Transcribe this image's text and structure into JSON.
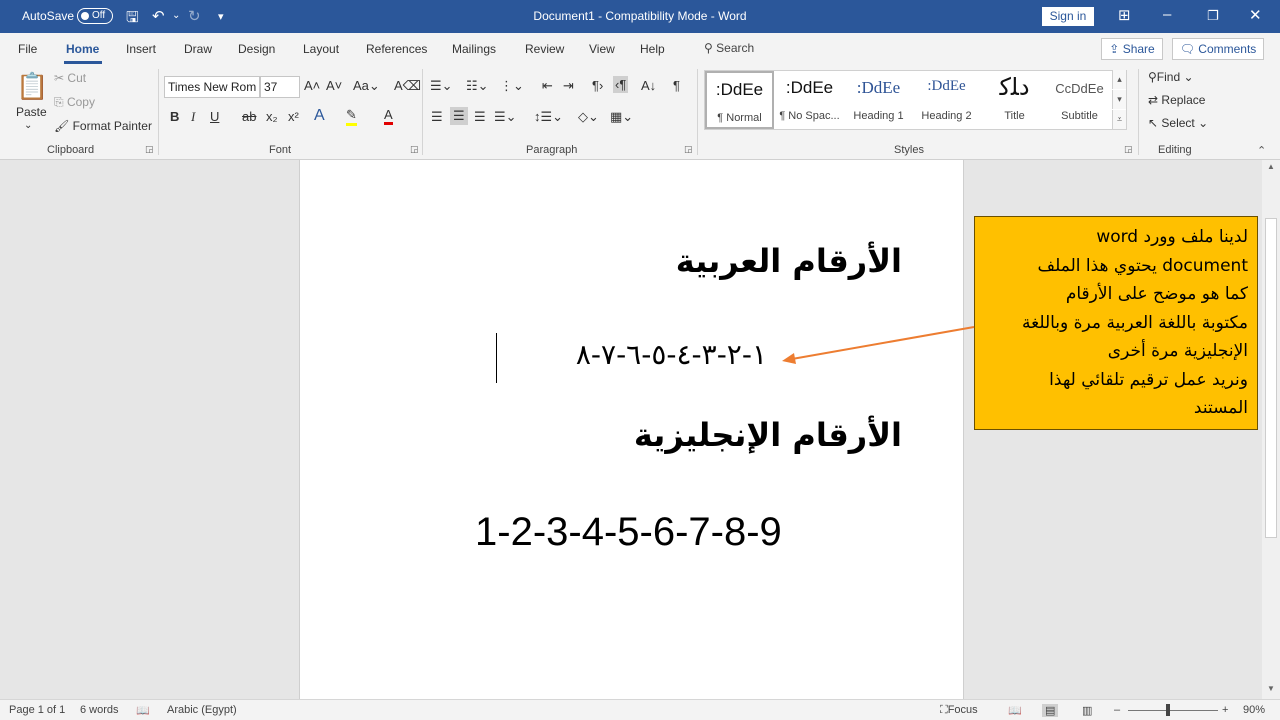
{
  "titlebar": {
    "autosave_label": "AutoSave",
    "autosave_state": "Off",
    "doc_title": "Document1  -  Compatibility Mode  -  Word",
    "signin_label": "Sign in"
  },
  "tabs": [
    "File",
    "Home",
    "Insert",
    "Draw",
    "Design",
    "Layout",
    "References",
    "Mailings",
    "Review",
    "View",
    "Help"
  ],
  "tellme": "Search",
  "share_label": "Share",
  "comments_label": "Comments",
  "clipboard": {
    "paste": "Paste",
    "cut": "Cut",
    "copy": "Copy",
    "format_painter": "Format Painter",
    "group": "Clipboard"
  },
  "font": {
    "name": "Times New Rom",
    "size": "37",
    "group": "Font"
  },
  "paragraph": {
    "group": "Paragraph"
  },
  "styles": {
    "group": "Styles",
    "items": [
      {
        "preview": ":DdEe",
        "name": "¶ Normal"
      },
      {
        "preview": ":DdEe",
        "name": "¶ No Spac..."
      },
      {
        "preview": ":DdEe",
        "name": "Heading 1"
      },
      {
        "preview": ":DdEe",
        "name": "Heading 2"
      },
      {
        "preview": "ﺩﻠﮐ",
        "name": "Title"
      },
      {
        "preview": "CcDdEe",
        "name": "Subtitle"
      }
    ]
  },
  "editing": {
    "find": "Find",
    "replace": "Replace",
    "select": "Select",
    "group": "Editing"
  },
  "document": {
    "heading_arabic": "الأرقام العربية",
    "arabic_numbers": "١-٢-٣-٤-٥-٦-٧-٨",
    "heading_english": "الأرقام الإنجليزية",
    "english_numbers": "1-2-3-4-5-6-7-8-9"
  },
  "callout": {
    "lines": [
      "لدينا ملف وورد  word",
      "document يحتوي هذا الملف",
      "كما هو موضح على الأرقام",
      "مكتوبة باللغة العربية مرة وباللغة",
      "الإنجليزية مرة أخرى",
      "ونريد عمل ترقيم تلقائي لهذا",
      "المستند"
    ]
  },
  "statusbar": {
    "page": "Page 1 of 1",
    "words": "6 words",
    "language": "Arabic (Egypt)",
    "focus": "Focus",
    "zoom": "90%"
  },
  "colors": {
    "title_bar": "#2b579a",
    "callout_fill": "#ffc000",
    "arrow": "#ed7d31"
  }
}
